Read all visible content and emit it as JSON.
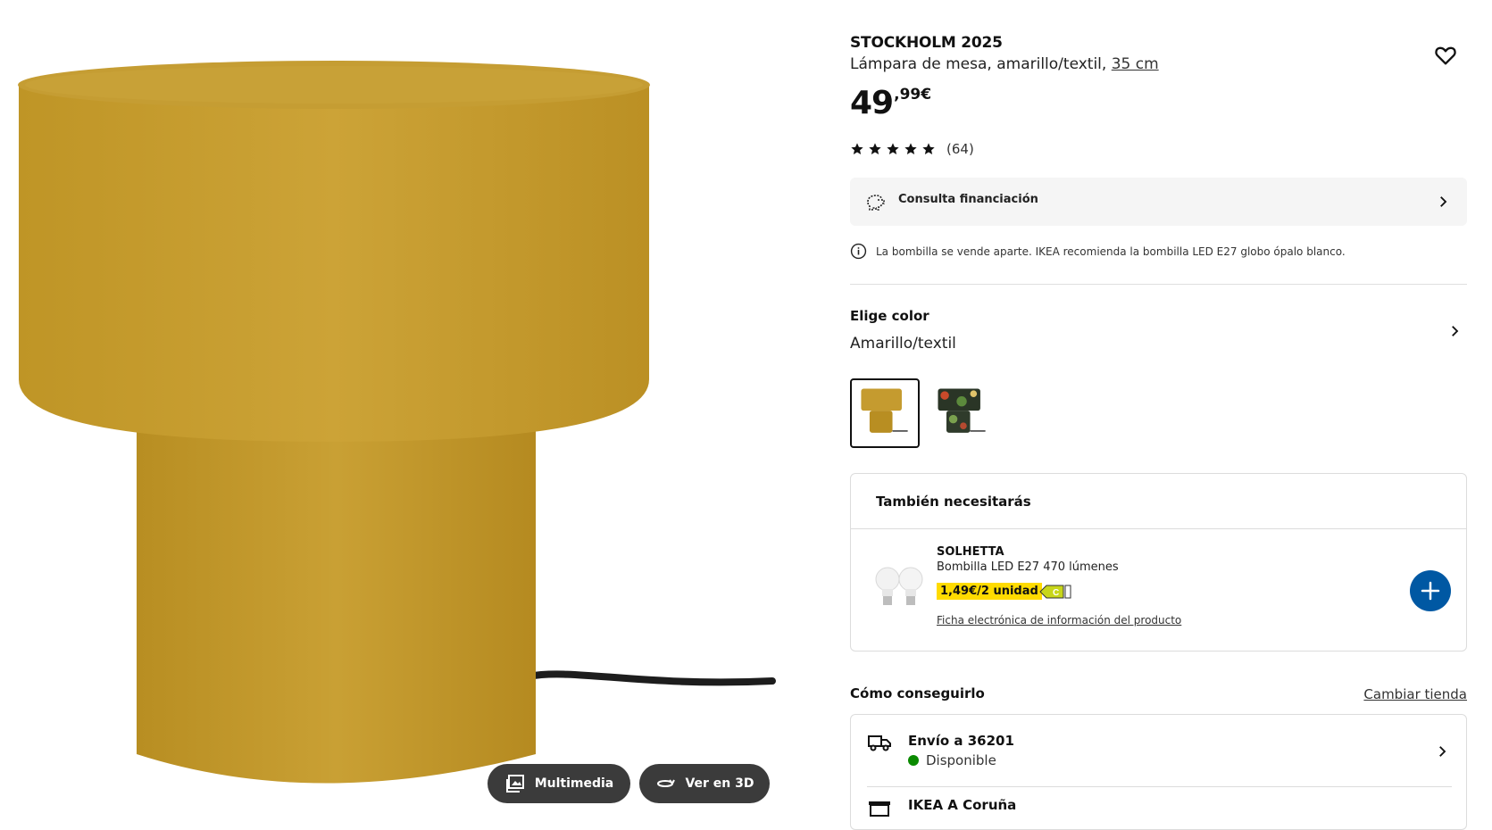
{
  "gallery": {
    "multimedia_label": "Multimedia",
    "view3d_label": "Ver en 3D"
  },
  "product": {
    "name": "STOCKHOLM 2025",
    "description": "Lámpara de mesa, amarillo/textil,",
    "size_link": "35 cm",
    "price_integer": "49",
    "price_decimal": ",99€",
    "rating_stars": 5,
    "rating_count": "(64)"
  },
  "finance": {
    "label": "Consulta financiación"
  },
  "notice": {
    "text": "La bombilla se vende aparte. IKEA recomienda la bombilla LED E27 globo ópalo blanco."
  },
  "color": {
    "title": "Elige color",
    "selected_value": "Amarillo/textil",
    "swatches": [
      "amarillo/textil",
      "multicolor/estampado"
    ]
  },
  "also_need": {
    "title": "También necesitarás",
    "item_name": "SOLHETTA",
    "item_desc": "Bombilla LED E27 470 lúmenes",
    "item_price": "1,49€/2 unidad",
    "energy_class": "C",
    "info_link": "Ficha electrónica de información del producto"
  },
  "get": {
    "title": "Cómo conseguirlo",
    "change_store": "Cambiar tienda",
    "shipping_title": "Envío a 36201",
    "shipping_status": "Disponible",
    "store_name": "IKEA A Coruña"
  },
  "colors": {
    "lamp_yellow": "#c9a032",
    "brand_blue": "#0058a3",
    "price_tag_yellow": "#ffdb00",
    "available_green": "#0a8a00"
  }
}
